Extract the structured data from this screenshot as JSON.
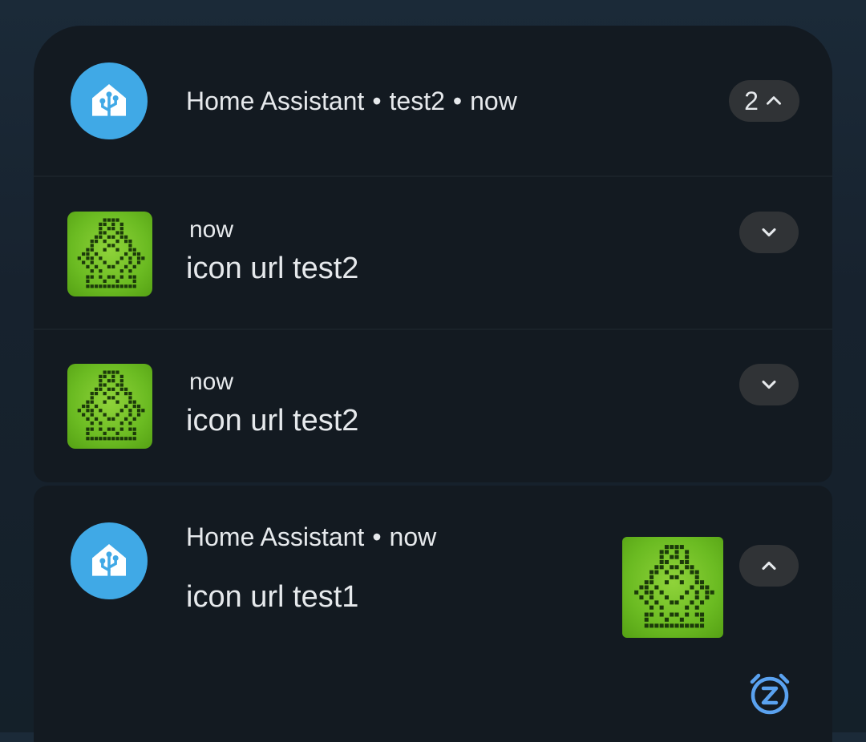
{
  "group": {
    "app_name": "Home Assistant",
    "sub_text": "test2",
    "time": "now",
    "count": "2",
    "expand_icon": "chevron-up-icon",
    "items": [
      {
        "time": "now",
        "message": "icon url test2",
        "expand_icon": "chevron-down-icon"
      },
      {
        "time": "now",
        "message": "icon url test2",
        "expand_icon": "chevron-down-icon"
      }
    ]
  },
  "single": {
    "app_name": "Home Assistant",
    "time": "now",
    "message": "icon url test1",
    "expand_icon": "chevron-up-icon",
    "action_icon": "snooze-icon"
  },
  "colors": {
    "app_icon_bg": "#40a9e6",
    "card_bg": "#131a21",
    "pill_bg": "#303336",
    "accent": "#5aa2f0"
  }
}
